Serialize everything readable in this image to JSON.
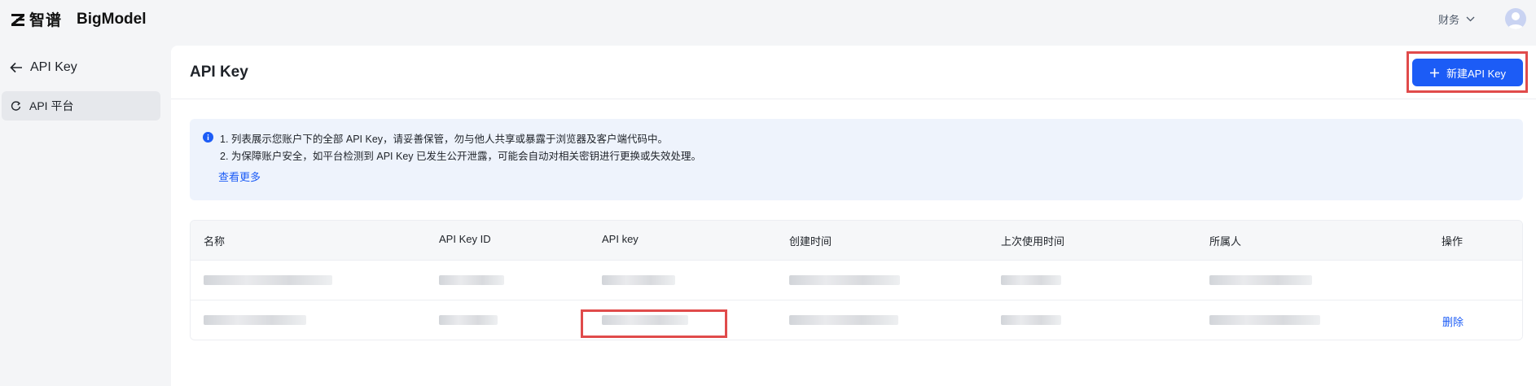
{
  "topbar": {
    "logo_zh": "智谱",
    "logo_en": "BigModel",
    "finance_label": "财务",
    "icons": {
      "logo": "zhipu-logo-icon",
      "chevron": "chevron-down-icon",
      "avatar": "user-avatar-icon"
    }
  },
  "sidebar": {
    "back_label": "API Key",
    "items": [
      {
        "label": "API 平台",
        "icon": "platform-icon",
        "active": true
      }
    ]
  },
  "main": {
    "title": "API Key",
    "create_button": "新建API Key",
    "info": {
      "line1": "1. 列表展示您账户下的全部 API Key，请妥善保管，勿与他人共享或暴露于浏览器及客户端代码中。",
      "line2": "2. 为保障账户安全，如平台检测到 API Key 已发生公开泄露，可能会自动对相关密钥进行更换或失效处理。",
      "more_link": "查看更多"
    },
    "table": {
      "columns": [
        "名称",
        "API Key ID",
        "API key",
        "创建时间",
        "上次使用时间",
        "所属人",
        "操作"
      ],
      "rows": [
        {
          "action": ""
        },
        {
          "action": "删除"
        }
      ]
    }
  },
  "colors": {
    "accent": "#1c5cf6",
    "highlight": "#e04b4b",
    "info_bg": "#eef3fc"
  }
}
